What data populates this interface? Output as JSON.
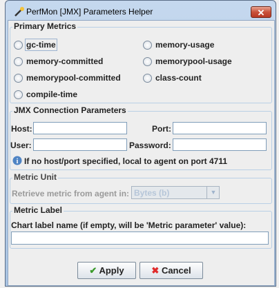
{
  "window": {
    "title": "PerfMon [JMX] Parameters Helper",
    "close": "✕"
  },
  "primary": {
    "title": "Primary Metrics",
    "options": [
      "gc-time",
      "memory-usage",
      "memory-committed",
      "memorypool-usage",
      "memorypool-committed",
      "class-count",
      "compile-time"
    ]
  },
  "jmx": {
    "title": "JMX Connection Parameters",
    "host_label": "Host:",
    "port_label": "Port:",
    "user_label": "User:",
    "password_label": "Password:",
    "host": "",
    "port": "",
    "user": "",
    "password": "",
    "info": "If no host/port specified, local to agent on port 4711"
  },
  "unit": {
    "title": "Metric Unit",
    "label": "Retrieve metric from agent in:",
    "selected": "Bytes (b)"
  },
  "label": {
    "title": "Metric Label",
    "text": "Chart label name (if empty, will be 'Metric parameter' value):",
    "value": ""
  },
  "buttons": {
    "apply": "Apply",
    "cancel": "Cancel"
  }
}
